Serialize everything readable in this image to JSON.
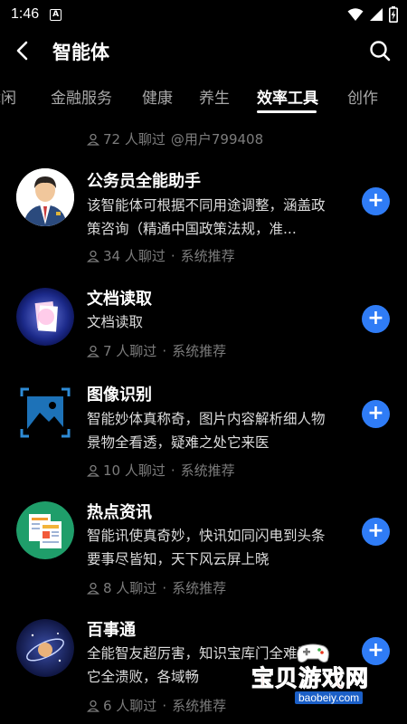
{
  "status": {
    "time": "1:46",
    "a_icon": "A"
  },
  "header": {
    "title": "智能体"
  },
  "tabs": [
    {
      "label": "休闲",
      "active": false
    },
    {
      "label": "金融服务",
      "active": false
    },
    {
      "label": "健康",
      "active": false
    },
    {
      "label": "养生",
      "active": false
    },
    {
      "label": "效率工具",
      "active": true
    },
    {
      "label": "创作",
      "active": false
    }
  ],
  "top_meta": {
    "count": "72 人聊过",
    "author": "@用户799408"
  },
  "items": [
    {
      "title": "公务员全能助手",
      "desc": "该智能体可根据不同用途调整，涵盖政策咨询（精通中国政策法规，准...",
      "count": "34 人聊过",
      "source": "系统推荐",
      "icon": "civil-servant-icon"
    },
    {
      "title": "文档读取",
      "desc": "文档读取",
      "count": "7 人聊过",
      "source": "系统推荐",
      "icon": "document-icon"
    },
    {
      "title": "图像识别",
      "desc": "智能妙体真称奇，图片内容解析细人物景物全看透，疑难之处它来医",
      "count": "10 人聊过",
      "source": "系统推荐",
      "icon": "image-recognition-icon"
    },
    {
      "title": "热点资讯",
      "desc": "智能讯使真奇妙，快讯如同闪电到头条要事尽皆知，天下风云屏上晓",
      "count": "8 人聊过",
      "source": "系统推荐",
      "icon": "news-icon"
    },
    {
      "title": "百事通",
      "desc": "全能智友超厉害，知识宝库门全难题见它全溃败，各域畅",
      "count": "6 人聊过",
      "source": "系统推荐",
      "icon": "galaxy-icon"
    }
  ],
  "watermark": {
    "text": "宝贝游戏网",
    "url": "baobeiy.com"
  },
  "colors": {
    "accent": "#2f7cf6",
    "background": "#000000",
    "muted": "#7c7c7c"
  }
}
